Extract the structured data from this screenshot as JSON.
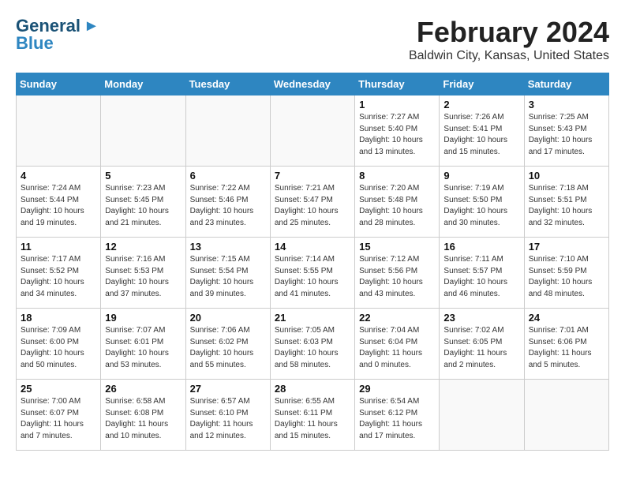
{
  "logo": {
    "line1": "General",
    "line2": "Blue"
  },
  "header": {
    "month_year": "February 2024",
    "location": "Baldwin City, Kansas, United States"
  },
  "days_of_week": [
    "Sunday",
    "Monday",
    "Tuesday",
    "Wednesday",
    "Thursday",
    "Friday",
    "Saturday"
  ],
  "weeks": [
    [
      {
        "day": "",
        "info": ""
      },
      {
        "day": "",
        "info": ""
      },
      {
        "day": "",
        "info": ""
      },
      {
        "day": "",
        "info": ""
      },
      {
        "day": "1",
        "info": "Sunrise: 7:27 AM\nSunset: 5:40 PM\nDaylight: 10 hours\nand 13 minutes."
      },
      {
        "day": "2",
        "info": "Sunrise: 7:26 AM\nSunset: 5:41 PM\nDaylight: 10 hours\nand 15 minutes."
      },
      {
        "day": "3",
        "info": "Sunrise: 7:25 AM\nSunset: 5:43 PM\nDaylight: 10 hours\nand 17 minutes."
      }
    ],
    [
      {
        "day": "4",
        "info": "Sunrise: 7:24 AM\nSunset: 5:44 PM\nDaylight: 10 hours\nand 19 minutes."
      },
      {
        "day": "5",
        "info": "Sunrise: 7:23 AM\nSunset: 5:45 PM\nDaylight: 10 hours\nand 21 minutes."
      },
      {
        "day": "6",
        "info": "Sunrise: 7:22 AM\nSunset: 5:46 PM\nDaylight: 10 hours\nand 23 minutes."
      },
      {
        "day": "7",
        "info": "Sunrise: 7:21 AM\nSunset: 5:47 PM\nDaylight: 10 hours\nand 25 minutes."
      },
      {
        "day": "8",
        "info": "Sunrise: 7:20 AM\nSunset: 5:48 PM\nDaylight: 10 hours\nand 28 minutes."
      },
      {
        "day": "9",
        "info": "Sunrise: 7:19 AM\nSunset: 5:50 PM\nDaylight: 10 hours\nand 30 minutes."
      },
      {
        "day": "10",
        "info": "Sunrise: 7:18 AM\nSunset: 5:51 PM\nDaylight: 10 hours\nand 32 minutes."
      }
    ],
    [
      {
        "day": "11",
        "info": "Sunrise: 7:17 AM\nSunset: 5:52 PM\nDaylight: 10 hours\nand 34 minutes."
      },
      {
        "day": "12",
        "info": "Sunrise: 7:16 AM\nSunset: 5:53 PM\nDaylight: 10 hours\nand 37 minutes."
      },
      {
        "day": "13",
        "info": "Sunrise: 7:15 AM\nSunset: 5:54 PM\nDaylight: 10 hours\nand 39 minutes."
      },
      {
        "day": "14",
        "info": "Sunrise: 7:14 AM\nSunset: 5:55 PM\nDaylight: 10 hours\nand 41 minutes."
      },
      {
        "day": "15",
        "info": "Sunrise: 7:12 AM\nSunset: 5:56 PM\nDaylight: 10 hours\nand 43 minutes."
      },
      {
        "day": "16",
        "info": "Sunrise: 7:11 AM\nSunset: 5:57 PM\nDaylight: 10 hours\nand 46 minutes."
      },
      {
        "day": "17",
        "info": "Sunrise: 7:10 AM\nSunset: 5:59 PM\nDaylight: 10 hours\nand 48 minutes."
      }
    ],
    [
      {
        "day": "18",
        "info": "Sunrise: 7:09 AM\nSunset: 6:00 PM\nDaylight: 10 hours\nand 50 minutes."
      },
      {
        "day": "19",
        "info": "Sunrise: 7:07 AM\nSunset: 6:01 PM\nDaylight: 10 hours\nand 53 minutes."
      },
      {
        "day": "20",
        "info": "Sunrise: 7:06 AM\nSunset: 6:02 PM\nDaylight: 10 hours\nand 55 minutes."
      },
      {
        "day": "21",
        "info": "Sunrise: 7:05 AM\nSunset: 6:03 PM\nDaylight: 10 hours\nand 58 minutes."
      },
      {
        "day": "22",
        "info": "Sunrise: 7:04 AM\nSunset: 6:04 PM\nDaylight: 11 hours\nand 0 minutes."
      },
      {
        "day": "23",
        "info": "Sunrise: 7:02 AM\nSunset: 6:05 PM\nDaylight: 11 hours\nand 2 minutes."
      },
      {
        "day": "24",
        "info": "Sunrise: 7:01 AM\nSunset: 6:06 PM\nDaylight: 11 hours\nand 5 minutes."
      }
    ],
    [
      {
        "day": "25",
        "info": "Sunrise: 7:00 AM\nSunset: 6:07 PM\nDaylight: 11 hours\nand 7 minutes."
      },
      {
        "day": "26",
        "info": "Sunrise: 6:58 AM\nSunset: 6:08 PM\nDaylight: 11 hours\nand 10 minutes."
      },
      {
        "day": "27",
        "info": "Sunrise: 6:57 AM\nSunset: 6:10 PM\nDaylight: 11 hours\nand 12 minutes."
      },
      {
        "day": "28",
        "info": "Sunrise: 6:55 AM\nSunset: 6:11 PM\nDaylight: 11 hours\nand 15 minutes."
      },
      {
        "day": "29",
        "info": "Sunrise: 6:54 AM\nSunset: 6:12 PM\nDaylight: 11 hours\nand 17 minutes."
      },
      {
        "day": "",
        "info": ""
      },
      {
        "day": "",
        "info": ""
      }
    ]
  ]
}
